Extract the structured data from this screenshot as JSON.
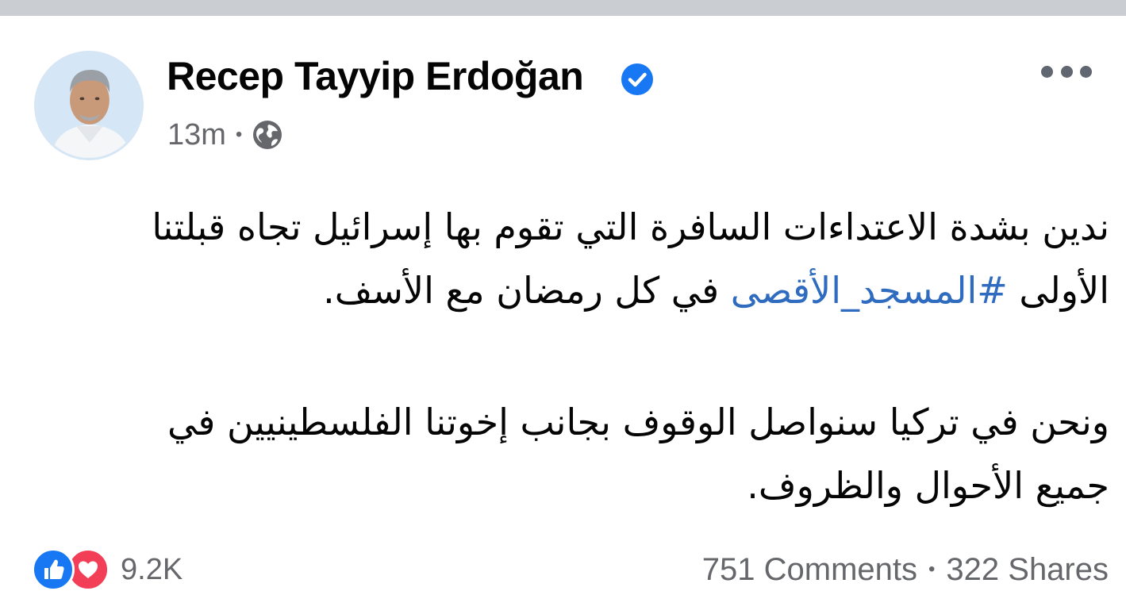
{
  "post": {
    "author_name": "Recep Tayyip Erdoğan",
    "verified": true,
    "timestamp": "13m",
    "separator": "•",
    "audience_icon": "globe-icon",
    "paragraph1_before": "ندين بشدة الاعتداءات السافرة التي تقوم بها إسرائيل تجاه قبلتنا الأولى ",
    "hashtag": "#المسجد_الأقصى",
    "paragraph1_after": " في كل رمضان مع الأسف.",
    "paragraph2": "ونحن في تركيا سنواصل الوقوف بجانب إخوتنا الفلسطينيين في جميع الأحوال والظروف."
  },
  "reactions": {
    "icons": [
      "like-icon",
      "love-icon"
    ],
    "count": "9.2K"
  },
  "stats": {
    "comments": "751 Comments",
    "separator": "•",
    "shares": "322 Shares"
  },
  "colors": {
    "link": "#2f6bbf",
    "verified": "#1877f2",
    "like": "#1877f2",
    "love": "#f33e58",
    "secondary_text": "#65676b"
  }
}
